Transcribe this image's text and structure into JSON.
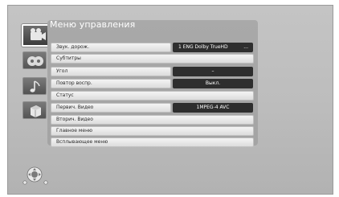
{
  "menu": {
    "title": "Меню управления",
    "rows": [
      {
        "label": "Звук. дорож.",
        "value": "1 ENG Dolby TrueHD",
        "value2": "..."
      },
      {
        "label": "Субтитры"
      },
      {
        "label": "Угол",
        "value": "–"
      },
      {
        "label": "Повтор воспр.",
        "value": "Выкл."
      },
      {
        "label": "Статус"
      },
      {
        "label": "Первич. Видео",
        "value": "1MPEG-4 AVC"
      },
      {
        "label": "Вторич. Видео"
      },
      {
        "label": "Главное меню"
      },
      {
        "label": "Всплывающее меню"
      }
    ]
  },
  "sidebar": {
    "items": [
      {
        "icon": "disc-playback-icon",
        "selected": true
      },
      {
        "icon": "sd-card-icon"
      },
      {
        "icon": "music-note-icon"
      },
      {
        "icon": "photo-icon"
      }
    ]
  },
  "controls": {
    "icon": "navigation-pad-icon"
  },
  "colors": {
    "background": "#bdbdbd",
    "row": "#e6e6e6",
    "value_box": "#2e2e2e",
    "title_text": "#ffffff"
  }
}
